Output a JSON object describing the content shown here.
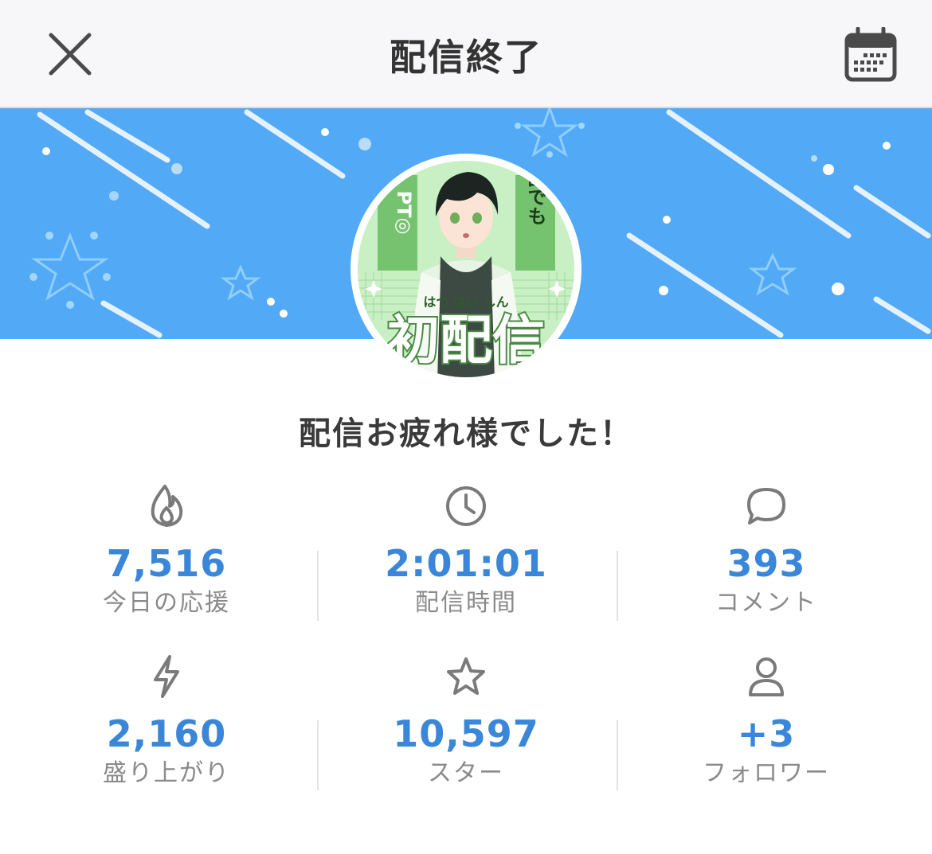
{
  "header": {
    "title": "配信終了",
    "close_icon": "close-icon",
    "calendar_icon": "calendar-icon"
  },
  "banner": {
    "background_color": "#52a9f5",
    "avatar": {
      "vertical_text_right": "誰でも",
      "vertical_text_left": "PT◎",
      "ruby_text": "はつ はい しん",
      "big_text": "初配信"
    }
  },
  "thanks_message": "配信お疲れ様でした！",
  "stats": [
    {
      "icon": "fire-icon",
      "value": "7,516",
      "label": "今日の応援"
    },
    {
      "icon": "clock-icon",
      "value": "2:01:01",
      "label": "配信時間"
    },
    {
      "icon": "comment-icon",
      "value": "393",
      "label": "コメント"
    },
    {
      "icon": "lightning-icon",
      "value": "2,160",
      "label": "盛り上がり"
    },
    {
      "icon": "star-icon",
      "value": "10,597",
      "label": "スター"
    },
    {
      "icon": "person-icon",
      "value": "+3",
      "label": "フォロワー"
    }
  ],
  "colors": {
    "accent": "#3a86d8",
    "label": "#8a8a8a",
    "icon": "#7a7a7a"
  }
}
